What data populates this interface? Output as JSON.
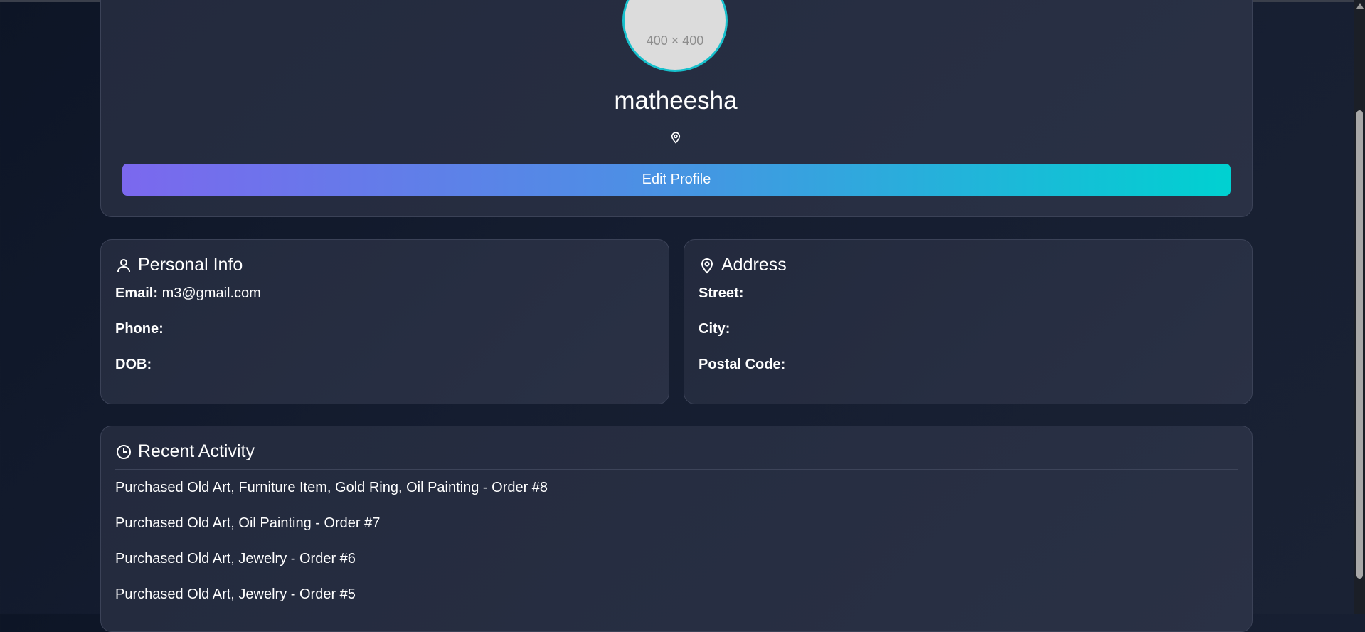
{
  "profile": {
    "avatar_placeholder": "400 × 400",
    "username": "matheesha",
    "edit_button_label": "Edit Profile"
  },
  "personal_info": {
    "title": "Personal Info",
    "email_label": "Email:",
    "email_value": "m3@gmail.com",
    "phone_label": "Phone:",
    "dob_label": "DOB:"
  },
  "address": {
    "title": "Address",
    "street_label": "Street:",
    "city_label": "City:",
    "postal_label": "Postal Code:"
  },
  "activity": {
    "title": "Recent Activity",
    "items": [
      "Purchased Old Art, Furniture Item, Gold Ring, Oil Painting - Order #8",
      "Purchased Old Art, Oil Painting - Order #7",
      "Purchased Old Art, Jewelry - Order #6",
      "Purchased Old Art, Jewelry - Order #5"
    ]
  },
  "colors": {
    "accent_start": "#7b68ee",
    "accent_end": "#00d1d1",
    "avatar_border": "#17c0cc"
  },
  "icons": [
    "location-pin-icon",
    "user-icon",
    "map-pin-icon",
    "clock-icon",
    "scroll-up-arrow-icon"
  ]
}
